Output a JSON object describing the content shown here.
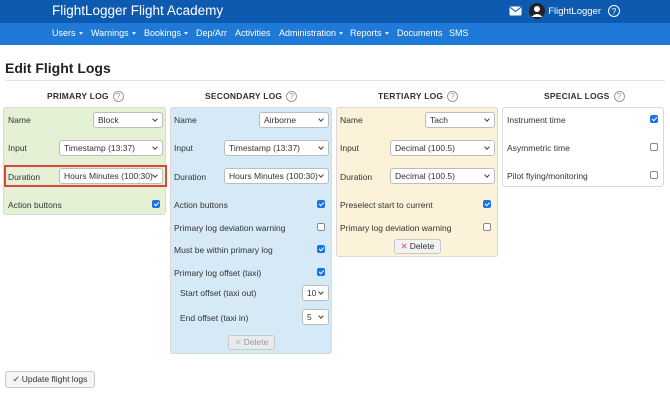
{
  "header": {
    "brand": "FlightLogger Flight Academy",
    "username": "FlightLogger",
    "help_glyph": "?"
  },
  "nav": {
    "items": [
      {
        "label": "Users",
        "dropdown": true
      },
      {
        "label": "Warnings",
        "dropdown": true
      },
      {
        "label": "Bookings",
        "dropdown": true
      },
      {
        "label": "Dep/Arr",
        "dropdown": false
      },
      {
        "label": "Activities",
        "dropdown": false
      },
      {
        "label": "Administration",
        "dropdown": true
      },
      {
        "label": "Reports",
        "dropdown": true
      },
      {
        "label": "Documents",
        "dropdown": false
      },
      {
        "label": "SMS",
        "dropdown": false
      }
    ]
  },
  "page_title": "Edit Flight Logs",
  "primary": {
    "title": "PRIMARY LOG",
    "name_label": "Name",
    "name_value": "Block",
    "input_label": "Input",
    "input_value": "Timestamp (13:37)",
    "duration_label": "Duration",
    "duration_value": "Hours Minutes (100:30)",
    "action_buttons_label": "Action buttons",
    "action_buttons_checked": true
  },
  "secondary": {
    "title": "SECONDARY LOG",
    "name_label": "Name",
    "name_value": "Airborne",
    "input_label": "Input",
    "input_value": "Timestamp (13:37)",
    "duration_label": "Duration",
    "duration_value": "Hours Minutes (100:30)",
    "action_buttons_label": "Action buttons",
    "action_buttons_checked": true,
    "deviation_label": "Primary log deviation warning",
    "deviation_checked": false,
    "within_label": "Must be within primary log",
    "within_checked": true,
    "offset_label": "Primary log offset (taxi)",
    "offset_checked": true,
    "start_offset_label": "Start offset (taxi out)",
    "start_offset_value": "10",
    "end_offset_label": "End offset (taxi in)",
    "end_offset_value": "5",
    "delete_label": "Delete"
  },
  "tertiary": {
    "title": "TERTIARY LOG",
    "name_label": "Name",
    "name_value": "Tach",
    "input_label": "Input",
    "input_value": "Decimal (100.5)",
    "duration_label": "Duration",
    "duration_value": "Decimal (100.5)",
    "preselect_label": "Preselect start to current",
    "preselect_checked": true,
    "deviation_label": "Primary log deviation warning",
    "deviation_checked": false,
    "delete_label": "Delete"
  },
  "special": {
    "title": "SPECIAL LOGS",
    "instrument_label": "Instrument time",
    "instrument_checked": true,
    "asymmetric_label": "Asymmetric time",
    "asymmetric_checked": false,
    "pilot_label": "Pilot flying/monitoring",
    "pilot_checked": false
  },
  "update_button": "Update flight logs",
  "colors": {
    "topbar": "#0d5ab0",
    "navbar": "#1e7ad6",
    "primary_panel": "#e4f1d5",
    "secondary_panel": "#d6e9f6",
    "tertiary_panel": "#fbf2d9",
    "checkbox_on": "#1a73e8",
    "highlight": "#d9483b"
  },
  "icons": [
    "mail-icon",
    "user-avatar-icon",
    "help-icon",
    "caret-down-icon",
    "close-x-icon",
    "checkmark-icon"
  ]
}
